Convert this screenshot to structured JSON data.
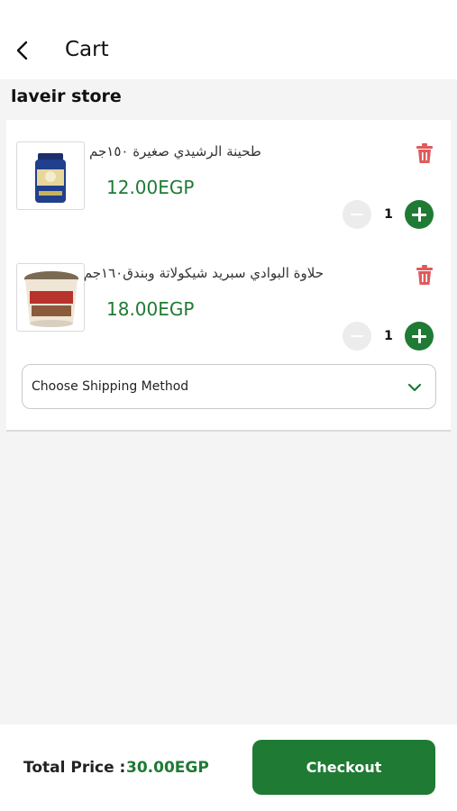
{
  "header": {
    "title": "Cart",
    "back_icon": "chevron-left-icon"
  },
  "store": {
    "name": "laveir store"
  },
  "items": [
    {
      "name": "طحينة الرشيدي صغيرة ١٥٠جم",
      "price": "12.00EGP",
      "quantity": "1",
      "image": "tahini-jar-image"
    },
    {
      "name": "حلاوة البوادي سبريد شيكولاتة وبندق١٦٠جم",
      "price": "18.00EGP",
      "quantity": "1",
      "image": "halawa-cup-image"
    }
  ],
  "shipping": {
    "placeholder": "Choose Shipping Method"
  },
  "footer": {
    "total_label": "Total Price :",
    "total_value": "30.00EGP",
    "checkout_label": "Checkout"
  },
  "colors": {
    "accent": "#1f7a34",
    "delete": "#e05a5a",
    "background": "#f4f4f4"
  }
}
